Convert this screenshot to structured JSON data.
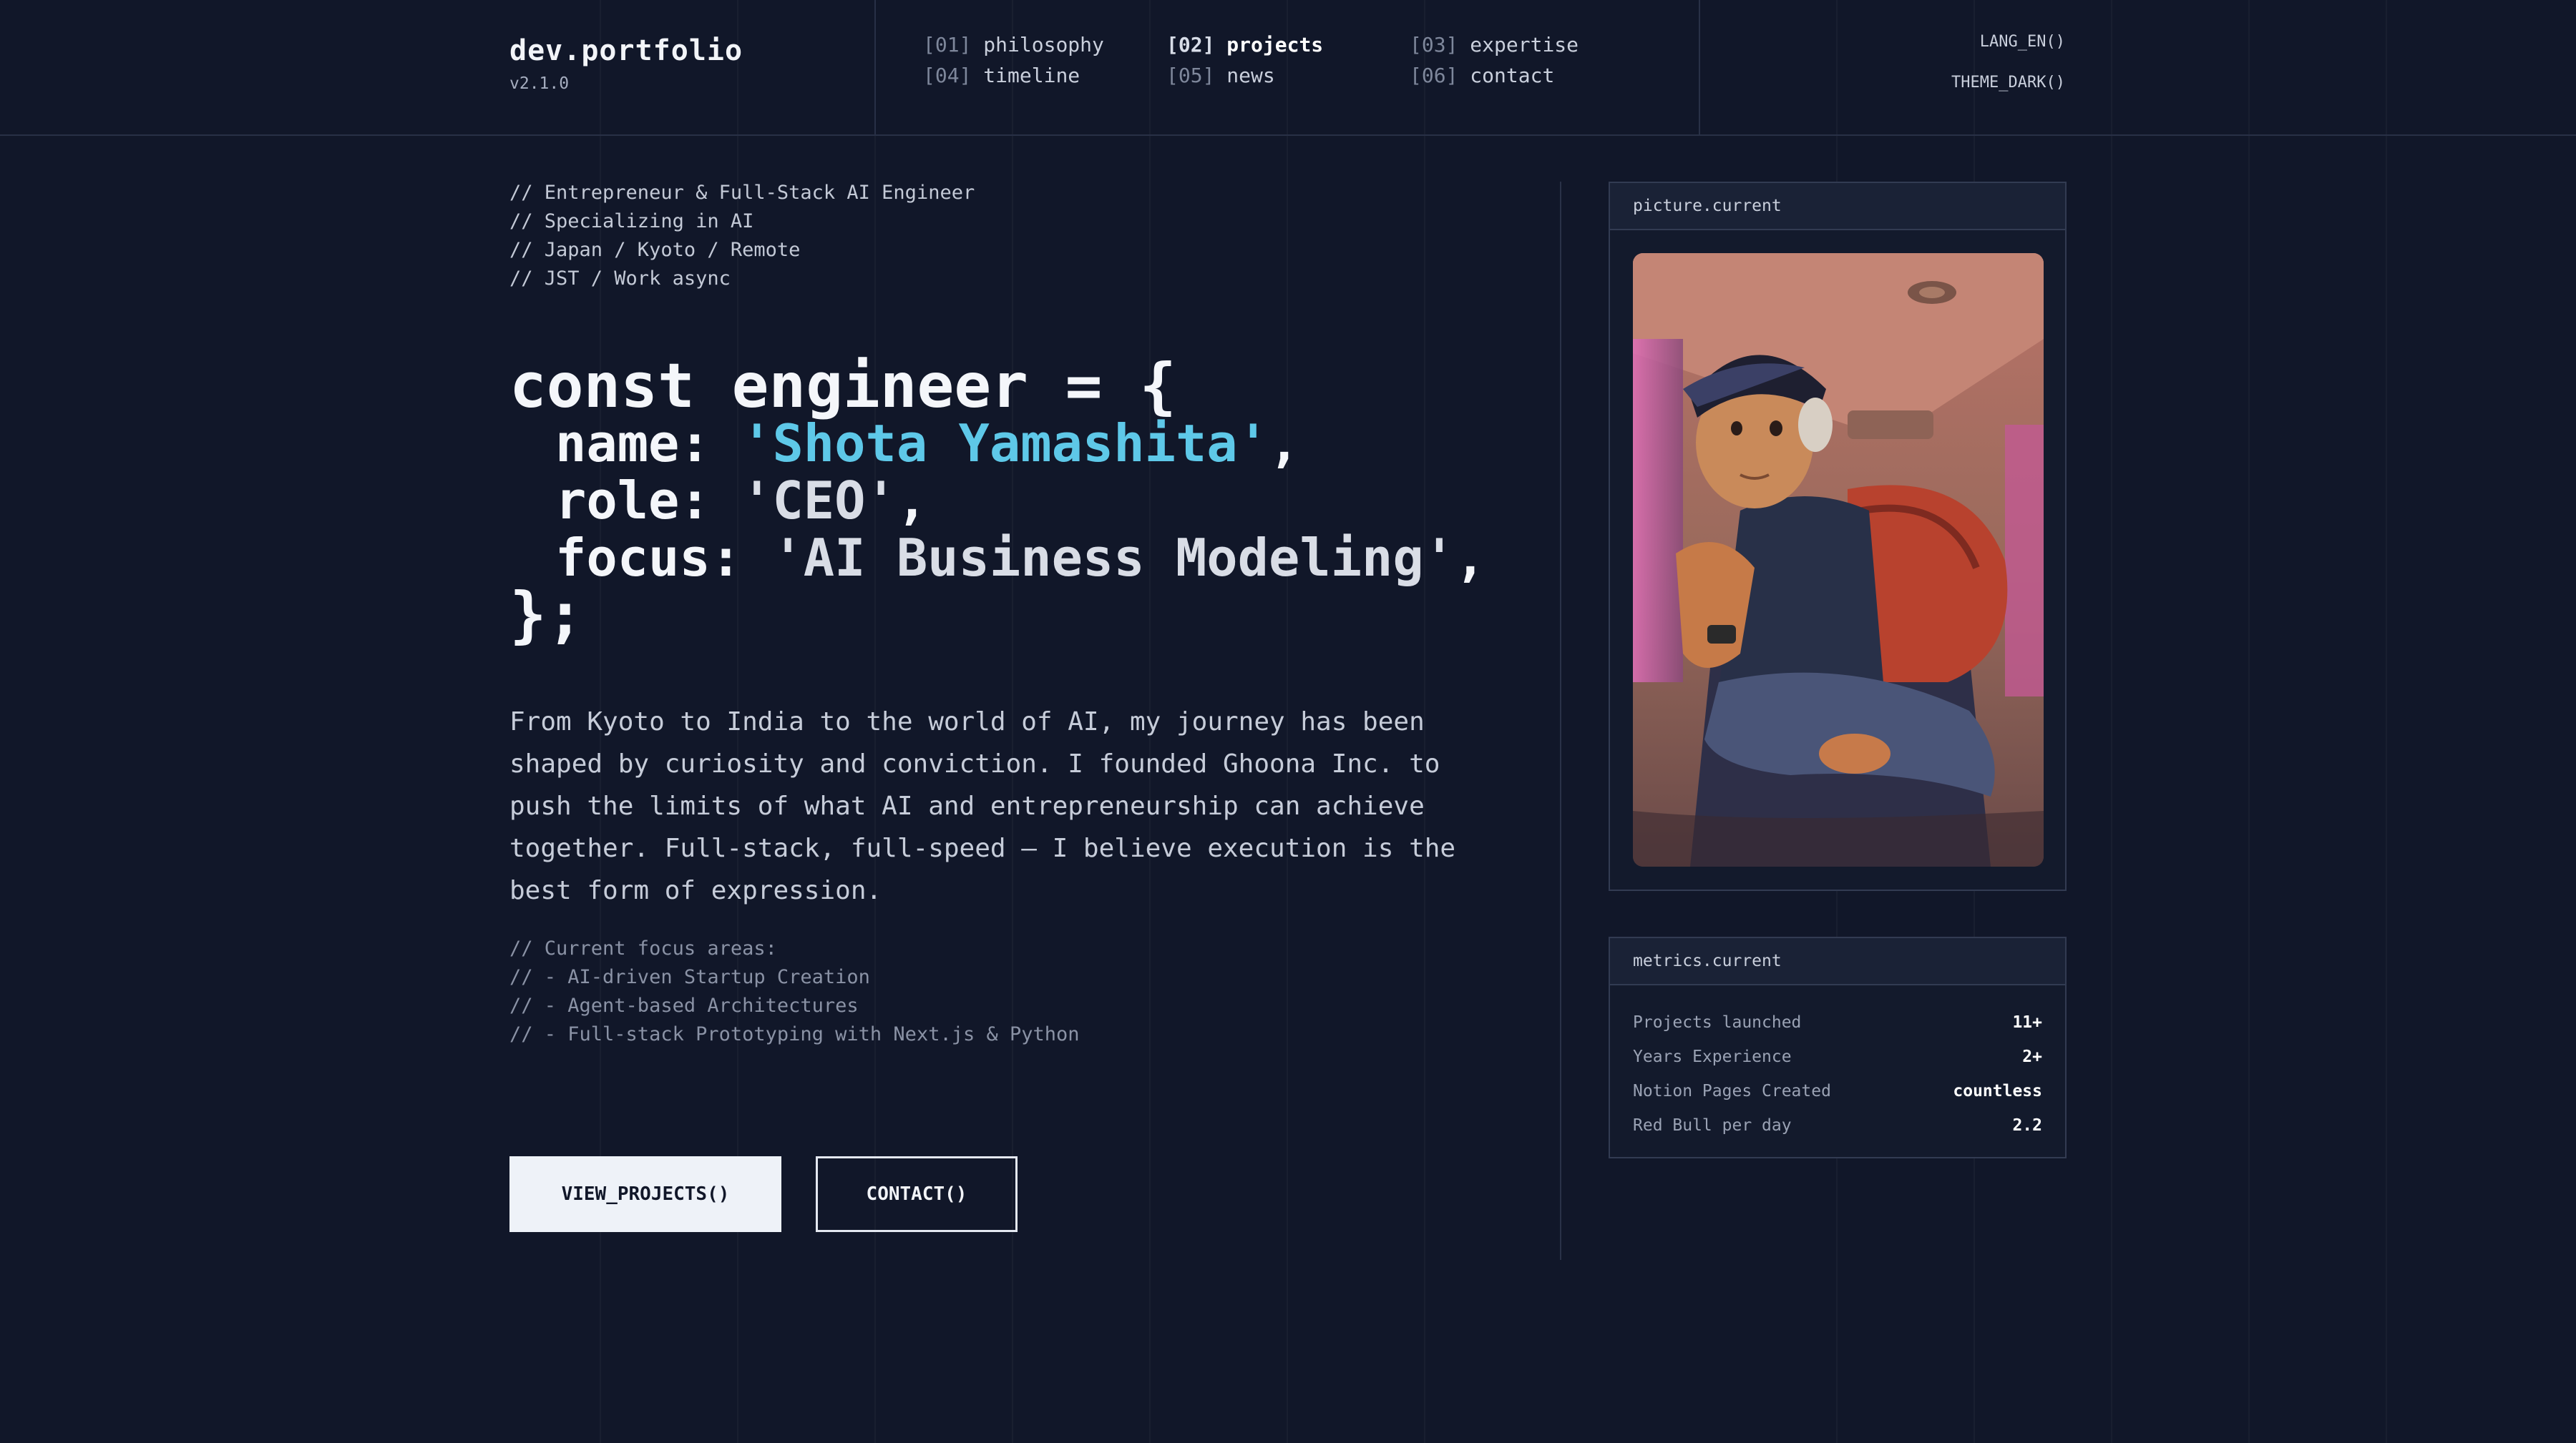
{
  "header": {
    "brand_title": "dev.portfolio",
    "brand_version": "v2.1.0",
    "nav": [
      {
        "num": "[01]",
        "label": "philosophy",
        "active": false
      },
      {
        "num": "[02]",
        "label": "projects",
        "active": true
      },
      {
        "num": "[03]",
        "label": "expertise",
        "active": false
      },
      {
        "num": "[04]",
        "label": "timeline",
        "active": false
      },
      {
        "num": "[05]",
        "label": "news",
        "active": false
      },
      {
        "num": "[06]",
        "label": "contact",
        "active": false
      }
    ],
    "lang_button": "LANG_EN()",
    "theme_button": "THEME_DARK()"
  },
  "intro": {
    "comments": [
      "// Entrepreneur & Full-Stack AI Engineer",
      "// Specializing in AI",
      "// Japan / Kyoto / Remote",
      "// JST / Work async"
    ]
  },
  "code": {
    "open": "const engineer = {",
    "name_key": "name: ",
    "name_value": "'Shota Yamashita'",
    "role_key": "role: ",
    "role_value": "'CEO'",
    "focus_key": "focus: ",
    "focus_value": "'AI Business Modeling'",
    "comma": ",",
    "close": "};"
  },
  "bio": "From Kyoto to India to the world of AI, my journey has been shaped by curiosity and conviction. I founded Ghoona Inc. to push the limits of what AI and entrepreneurship can achieve together. Full-stack, full-speed — I believe execution is the best form of expression.",
  "focus_areas": [
    "// Current focus areas:",
    "// - AI-driven Startup Creation",
    "// - Agent-based Architectures",
    "// - Full-stack Prototyping with Next.js & Python"
  ],
  "buttons": {
    "view_projects": "VIEW_PROJECTS()",
    "contact": "CONTACT()"
  },
  "picture_panel": {
    "title": "picture.current"
  },
  "metrics_panel": {
    "title": "metrics.current",
    "rows": [
      {
        "label": "Projects launched",
        "value": "11+"
      },
      {
        "label": "Years Experience",
        "value": "2+"
      },
      {
        "label": "Notion Pages Created",
        "value": "countless"
      },
      {
        "label": "Red Bull per day",
        "value": "2.2"
      }
    ]
  },
  "colors": {
    "background": "#111729",
    "accent_cyan": "#5ec8e8",
    "text": "#e4e8f1"
  }
}
